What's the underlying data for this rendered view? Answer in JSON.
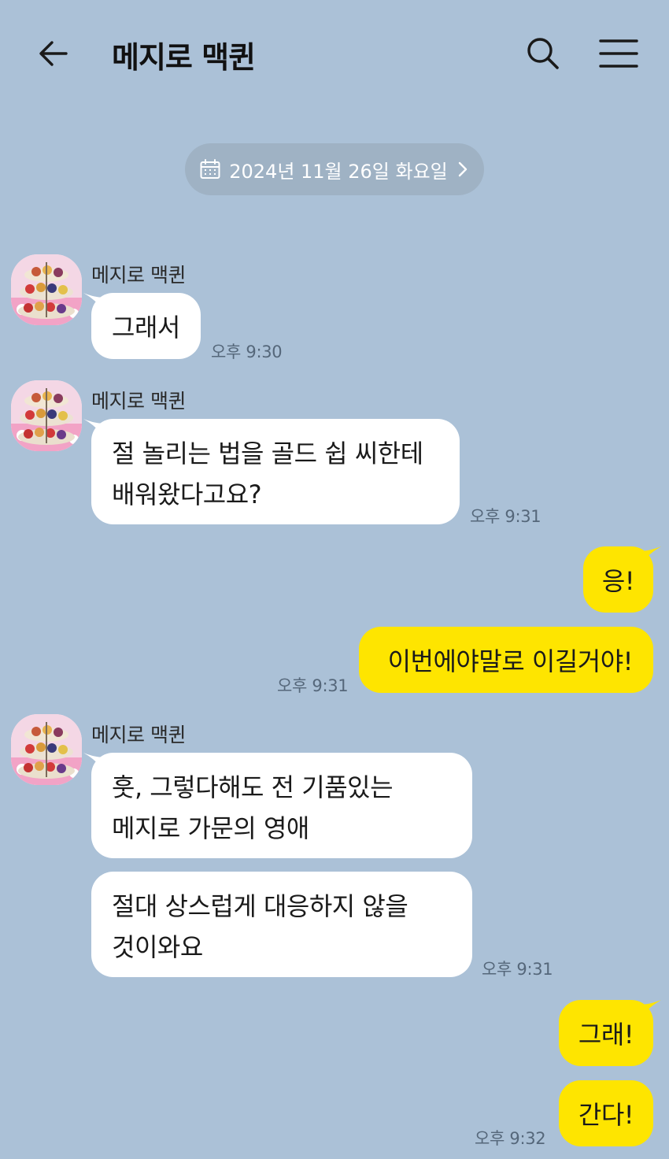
{
  "header": {
    "title": "메지로 맥퀸"
  },
  "date_pill": {
    "label": "2024년 11월 26일 화요일"
  },
  "messages": [
    {
      "sender": "메지로 맥퀸",
      "lines": [
        "그래서"
      ],
      "time": "오후 9:30"
    },
    {
      "sender": "메지로 맥퀸",
      "lines": [
        "절 놀리는 법을 골드 쉽 씨한테",
        "배워왔다고요?"
      ],
      "time": "오후 9:31"
    },
    {
      "lines": [
        "응!"
      ]
    },
    {
      "lines": [
        "이번에야말로 이길거야!"
      ],
      "time": "오후 9:31"
    },
    {
      "sender": "메지로 맥퀸",
      "lines": [
        "훗, 그렇다해도 전 기품있는",
        "메지로 가문의 영애"
      ]
    },
    {
      "lines": [
        "절대 상스럽게 대응하지 않을",
        "것이와요"
      ],
      "time": "오후 9:31"
    },
    {
      "lines": [
        "그래!"
      ]
    },
    {
      "lines": [
        "간다!"
      ],
      "time": "오후 9:32"
    }
  ],
  "colors": {
    "background": "#abc1d7",
    "incoming_bubble": "#ffffff",
    "outgoing_bubble": "#fee500",
    "date_pill": "#9fb2c4"
  },
  "icons": [
    "back-arrow-icon",
    "search-icon",
    "hamburger-menu-icon",
    "calendar-icon",
    "chevron-right-icon"
  ]
}
